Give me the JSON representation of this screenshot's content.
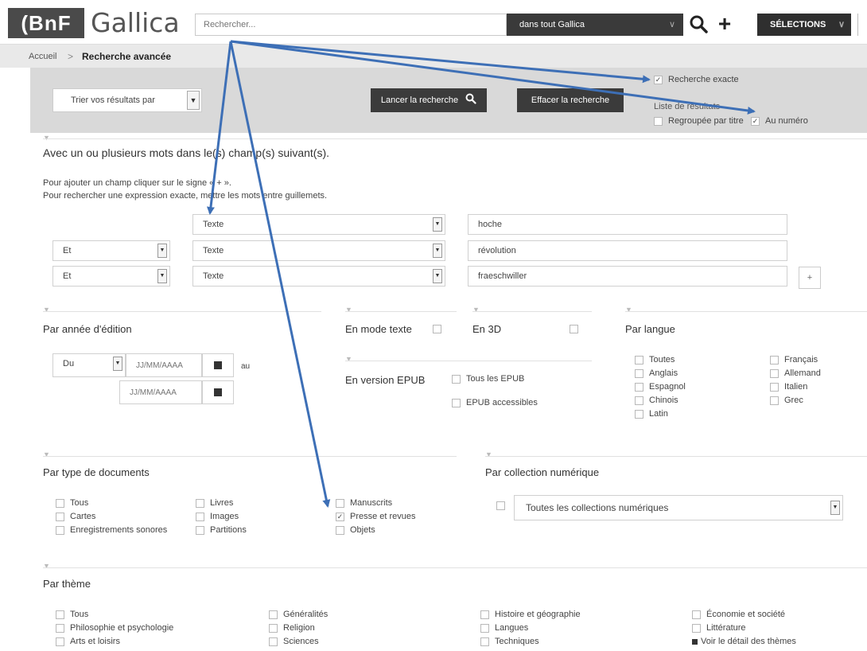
{
  "header": {
    "logo_bnf": "(BnF",
    "logo_gallica": "Gallica",
    "search_placeholder": "Rechercher...",
    "scope": "dans tout Gallica",
    "selections": "SÉLECTIONS"
  },
  "breadcrumb": {
    "home": "Accueil",
    "separator": ">",
    "current": "Recherche avancée"
  },
  "options": {
    "sort_label": "Trier vos résultats par",
    "launch_label": "Lancer la recherche",
    "erase_label": "Effacer la recherche",
    "exact_label": "Recherche exacte",
    "exact_checked": true,
    "list_label": "Liste de résultats",
    "group_label": "Regroupée par titre",
    "group_checked": false,
    "numero_label": "Au numéro",
    "numero_checked": true
  },
  "words": {
    "title": "Avec un ou plusieurs mots dans le(s) champ(s) suivant(s).",
    "help1": "Pour ajouter un champ cliquer sur le signe « + ».",
    "help2": "Pour rechercher une expression exacte, mettre les mots entre guillemets.",
    "rows": [
      {
        "operator": "",
        "field": "Texte",
        "value": "hoche"
      },
      {
        "operator": "Et",
        "field": "Texte",
        "value": "révolution"
      },
      {
        "operator": "Et",
        "field": "Texte",
        "value": "fraeschwiller"
      }
    ],
    "add_label": "+"
  },
  "year": {
    "title": "Par année d'édition",
    "from_select": "Du",
    "placeholder": "JJ/MM/AAAA",
    "to_label": "au"
  },
  "mode_texte": {
    "label": "En mode texte",
    "checked": false
  },
  "en_3d": {
    "label": "En 3D",
    "checked": false
  },
  "epub": {
    "title": "En version EPUB",
    "items": [
      {
        "label": "Tous les EPUB",
        "checked": false
      },
      {
        "label": "EPUB accessibles",
        "checked": false
      }
    ]
  },
  "langue": {
    "title": "Par langue",
    "col1": [
      {
        "label": "Toutes",
        "checked": false
      },
      {
        "label": "Anglais",
        "checked": false
      },
      {
        "label": "Espagnol",
        "checked": false
      },
      {
        "label": "Chinois",
        "checked": false
      },
      {
        "label": "Latin",
        "checked": false
      }
    ],
    "col2": [
      {
        "label": "Français",
        "checked": false
      },
      {
        "label": "Allemand",
        "checked": false
      },
      {
        "label": "Italien",
        "checked": false
      },
      {
        "label": "Grec",
        "checked": false
      }
    ]
  },
  "type_docs": {
    "title": "Par type de documents",
    "col1": [
      {
        "label": "Tous",
        "checked": false
      },
      {
        "label": "Cartes",
        "checked": false
      },
      {
        "label": "Enregistrements sonores",
        "checked": false
      }
    ],
    "col2": [
      {
        "label": "Livres",
        "checked": false
      },
      {
        "label": "Images",
        "checked": false
      },
      {
        "label": "Partitions",
        "checked": false
      }
    ],
    "col3": [
      {
        "label": "Manuscrits",
        "checked": false
      },
      {
        "label": "Presse et revues",
        "checked": true
      },
      {
        "label": "Objets",
        "checked": false
      }
    ]
  },
  "collection": {
    "title": "Par collection numérique",
    "value": "Toutes les collections numériques"
  },
  "theme": {
    "title": "Par thème",
    "col1": [
      {
        "label": "Tous",
        "checked": false
      },
      {
        "label": "Philosophie et psychologie",
        "checked": false
      },
      {
        "label": "Arts et loisirs",
        "checked": false
      }
    ],
    "col2": [
      {
        "label": "Généralités",
        "checked": false
      },
      {
        "label": "Religion",
        "checked": false
      },
      {
        "label": "Sciences",
        "checked": false
      }
    ],
    "col3": [
      {
        "label": "Histoire et géographie",
        "checked": false
      },
      {
        "label": "Langues",
        "checked": false
      },
      {
        "label": "Techniques",
        "checked": false
      }
    ],
    "col4": [
      {
        "label": "Économie et société",
        "checked": false
      },
      {
        "label": "Littérature",
        "checked": false
      }
    ],
    "detail_link": "Voir le détail des thèmes"
  },
  "colors": {
    "annotation_arrow": "#3d6fb6",
    "dark_button": "#3b3b3b",
    "options_band": "#d9d9d9"
  }
}
